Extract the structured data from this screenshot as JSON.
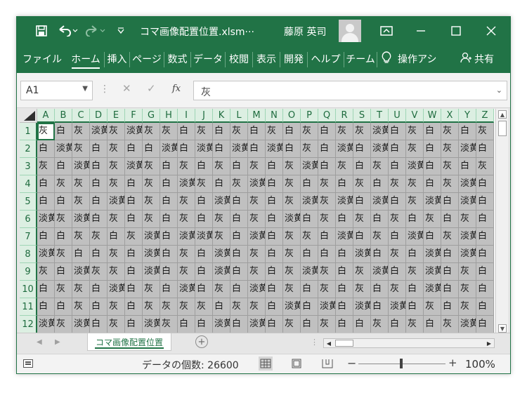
{
  "titlebar": {
    "filename": "コマ画像配置位置.xlsm···",
    "user": "藤原 英司",
    "icons": [
      "save-icon",
      "undo-icon",
      "redo-icon",
      "customize-qat-icon",
      "ribbon-display-icon",
      "minimize-icon",
      "maximize-icon",
      "close-icon"
    ],
    "color": "#217346"
  },
  "ribbon": {
    "tabs": [
      "ファイル",
      "ホーム",
      "挿入",
      "ページ",
      "数式",
      "データ",
      "校閲",
      "表示",
      "開発",
      "ヘルプ",
      "チーム"
    ],
    "active_tab": "ホーム",
    "tell_me": "操作アシ",
    "share": "共有"
  },
  "formula_bar": {
    "name_box": "A1",
    "formula_value": "灰",
    "fx_label": "fx"
  },
  "grid": {
    "columns": [
      "A",
      "B",
      "C",
      "D",
      "E",
      "F",
      "G",
      "H",
      "I",
      "J",
      "K",
      "L",
      "M",
      "N",
      "O",
      "P",
      "Q",
      "R",
      "S",
      "T",
      "U",
      "V",
      "W",
      "X",
      "Y",
      "Z"
    ],
    "rows": [
      "1",
      "2",
      "3",
      "4",
      "5",
      "6",
      "7",
      "8",
      "9",
      "10",
      "11",
      "12"
    ],
    "active_cell": "A1",
    "cells": [
      [
        "灰",
        "白",
        "灰",
        "淡黄",
        "灰",
        "淡黄",
        "灰",
        "灰",
        "白",
        "灰",
        "白",
        "灰",
        "白",
        "灰",
        "白",
        "灰",
        "白",
        "灰",
        "灰",
        "淡黄",
        "白",
        "灰",
        "白",
        "灰",
        "白",
        "灰"
      ],
      [
        "白",
        "淡黄",
        "灰",
        "白",
        "灰",
        "白",
        "白",
        "淡黄",
        "白",
        "淡黄",
        "白",
        "淡黄",
        "白",
        "淡黄",
        "白",
        "灰",
        "白",
        "淡黄",
        "白",
        "淡黄",
        "白",
        "灰",
        "白",
        "灰",
        "淡黄",
        "白"
      ],
      [
        "灰",
        "白",
        "淡黄",
        "白",
        "灰",
        "淡黄",
        "灰",
        "白",
        "灰",
        "白",
        "灰",
        "白",
        "灰",
        "白",
        "灰",
        "淡黄",
        "白",
        "灰",
        "白",
        "灰",
        "白",
        "淡黄",
        "白",
        "灰",
        "白",
        "灰"
      ],
      [
        "白",
        "灰",
        "灰",
        "白",
        "灰",
        "白",
        "灰",
        "白",
        "淡黄",
        "灰",
        "白",
        "灰",
        "淡黄",
        "白",
        "灰",
        "白",
        "灰",
        "白",
        "灰",
        "白",
        "灰",
        "灰",
        "白",
        "灰",
        "淡黄",
        "白"
      ],
      [
        "白",
        "白",
        "灰",
        "白",
        "淡黄",
        "白",
        "灰",
        "白",
        "灰",
        "白",
        "淡黄",
        "白",
        "灰",
        "白",
        "灰",
        "淡黄",
        "灰",
        "淡黄",
        "白",
        "淡黄",
        "白",
        "灰",
        "淡黄",
        "白",
        "淡黄",
        "白"
      ],
      [
        "淡黄",
        "灰",
        "淡黄",
        "白",
        "灰",
        "白",
        "灰",
        "白",
        "灰",
        "白",
        "灰",
        "白",
        "灰",
        "白",
        "淡黄",
        "白",
        "灰",
        "白",
        "灰",
        "白",
        "灰",
        "白",
        "灰",
        "白",
        "灰",
        "白"
      ],
      [
        "白",
        "白",
        "灰",
        "灰",
        "白",
        "灰",
        "淡黄",
        "白",
        "淡黄",
        "淡黄",
        "灰",
        "白",
        "淡黄",
        "白",
        "灰",
        "灰",
        "白",
        "淡黄",
        "白",
        "灰",
        "白",
        "淡黄",
        "白",
        "灰",
        "淡黄",
        "白"
      ],
      [
        "淡黄",
        "灰",
        "白",
        "白",
        "灰",
        "白",
        "淡黄",
        "白",
        "灰",
        "白",
        "淡黄",
        "白",
        "灰",
        "白",
        "灰",
        "白",
        "白",
        "白",
        "淡黄",
        "白",
        "灰",
        "白",
        "淡黄",
        "白",
        "淡黄",
        "白"
      ],
      [
        "灰",
        "白",
        "淡黄",
        "灰",
        "灰",
        "白",
        "淡黄",
        "白",
        "灰",
        "白",
        "淡黄",
        "白",
        "灰",
        "白",
        "灰",
        "淡黄",
        "灰",
        "白",
        "灰",
        "淡黄",
        "白",
        "灰",
        "淡黄",
        "白",
        "灰",
        "白"
      ],
      [
        "白",
        "灰",
        "灰",
        "白",
        "淡黄",
        "白",
        "灰",
        "白",
        "淡黄",
        "白",
        "灰",
        "白",
        "淡黄",
        "白",
        "灰",
        "白",
        "灰",
        "白",
        "灰",
        "白",
        "灰",
        "白",
        "淡黄",
        "白",
        "灰",
        "白"
      ],
      [
        "白",
        "白",
        "灰",
        "白",
        "灰",
        "白",
        "灰",
        "灰",
        "灰",
        "灰",
        "白",
        "灰",
        "灰",
        "白",
        "淡黄",
        "白",
        "淡黄",
        "白",
        "淡黄",
        "白",
        "淡黄",
        "白",
        "灰",
        "白",
        "灰",
        "白"
      ],
      [
        "淡黄",
        "灰",
        "淡黄",
        "白",
        "灰",
        "白",
        "淡黄",
        "灰",
        "白",
        "白",
        "淡黄",
        "白",
        "淡黄",
        "白",
        "灰",
        "白",
        "灰",
        "白",
        "白",
        "灰",
        "白",
        "灰",
        "白",
        "灰",
        "淡黄",
        "白"
      ]
    ]
  },
  "sheet_tabs": {
    "active": "コマ画像配置位置"
  },
  "status_bar": {
    "count_text": "データの個数: 26600",
    "zoom": "100%",
    "zoom_minus": "−",
    "zoom_plus": "+"
  }
}
